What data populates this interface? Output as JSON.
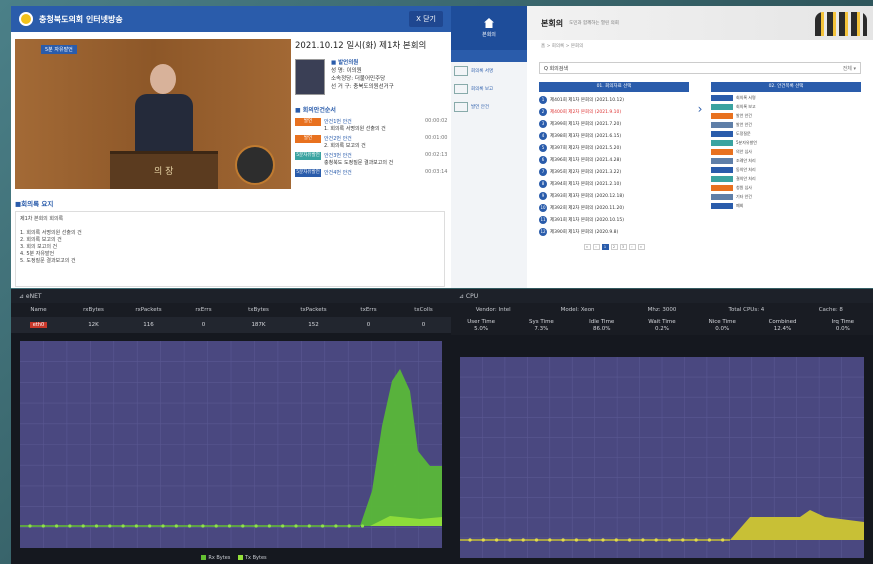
{
  "portal": {
    "site_name": "충청북도의회 인터넷방송",
    "close_label": "X 닫기",
    "date_title": "2021.10.12 일시(화) 제1차 본회의",
    "video_tag": "5분 자유발언",
    "podium_text": "의 장",
    "speaker": {
      "name_line": "■ 발언의원",
      "meta": [
        "성 명: 이의원",
        "소속정당: 더불어민주당",
        "선 거 구: 충북도의원선거구"
      ]
    },
    "agenda_title": "■ 회의안건순서",
    "agenda": [
      {
        "badge": "발언",
        "color": "orange",
        "title": "안건1번 안건",
        "desc": "1. 회의록 서명의원 선출의 건",
        "time": "00:00:02"
      },
      {
        "badge": "발언",
        "color": "orange",
        "title": "안건2번 안건",
        "desc": "2. 회의록 보고의 건",
        "time": "00:01:00"
      },
      {
        "badge": "5분자유발언",
        "color": "teal",
        "title": "안건3번 안건",
        "desc": "충청북도 도정질문 결과보고의 건",
        "time": "00:02:13"
      },
      {
        "badge": "5분자유발언",
        "color": "blue",
        "title": "안건4번 안건",
        "desc": "",
        "time": "00:03:14"
      }
    ],
    "summary_title": "■회의록 요지",
    "summary_lines": [
      "제1차 본회의 회의록",
      "",
      "1. 회의록 서명의원 선출의 건",
      "2. 회의록 보고의 건",
      "3. 회의 보고의 건",
      "4. 5분 자유발언",
      "5. 도정질문 결과보고의 건"
    ]
  },
  "assembly": {
    "home_label": "본회의",
    "banner_title": "본회의",
    "banner_sub": "도민과 함께하는 열린 의회",
    "breadcrumb": "홈 > 회의록 > 본회의",
    "search_text": "Q 회의검색",
    "search_filter": "전체 ▾",
    "left_col_title": "01. 회의자료 선택",
    "right_col_title": "02. 안건목록 선택",
    "sessions": [
      "제401회 제1차 본회의 (2021.10.12)",
      "제400회 제2차 본회의 (2021.9.10)",
      "제399회 제1차 본회의 (2021.7.20)",
      "제398회 제3차 본회의 (2021.6.15)",
      "제397회 제2차 본회의 (2021.5.20)",
      "제396회 제1차 본회의 (2021.4.28)",
      "제395회 제2차 본회의 (2021.3.22)",
      "제394회 제1차 본회의 (2021.2.10)",
      "제393회 제3차 본회의 (2020.12.18)",
      "제392회 제2차 본회의 (2020.11.20)",
      "제391회 제1차 본회의 (2020.10.15)",
      "제390회 제1차 본회의 (2020.9.8)"
    ],
    "items": [
      "회의록 서명",
      "회의록 보고",
      "발언 안건",
      "발언 안건",
      "도정질문",
      "5분자유발언",
      "의안 심사",
      "조례안 처리",
      "동의안 처리",
      "결의안 처리",
      "청원 심사",
      "기타 안건",
      "폐회"
    ],
    "pager": [
      "«",
      "‹",
      "1",
      "2",
      "3",
      "›",
      "»"
    ]
  },
  "net_monitor": {
    "title": "⊿ eNET",
    "headers": [
      "Name",
      "rxBytes",
      "rxPackets",
      "rxErrs",
      "txBytes",
      "txPackets",
      "txErrs",
      "txColls"
    ],
    "row": [
      "eth0",
      "12K",
      "116",
      "0",
      "187K",
      "152",
      "0",
      "0"
    ],
    "ylabel": "Bytes",
    "legend": [
      "Rx Bytes",
      "Tx Bytes"
    ],
    "colors": {
      "rx": "#64c032",
      "tx": "#94e03a"
    }
  },
  "cpu_monitor": {
    "title": "⊿ CPU",
    "info": [
      "Vendor: Intel",
      "Model: Xeon",
      "Mhz: 3000",
      "Total CPUs: 4",
      "Cache: 8"
    ],
    "headers": [
      "User Time",
      "Sys Time",
      "Idle Time",
      "Wait Time",
      "Nice Time",
      "Combined",
      "Irq Time"
    ],
    "row": [
      "5.0%",
      "7.3%",
      "86.0%",
      "0.2%",
      "0.0%",
      "12.4%",
      "0.0%"
    ],
    "ylabel": "Value",
    "color": "#c8c036"
  }
}
